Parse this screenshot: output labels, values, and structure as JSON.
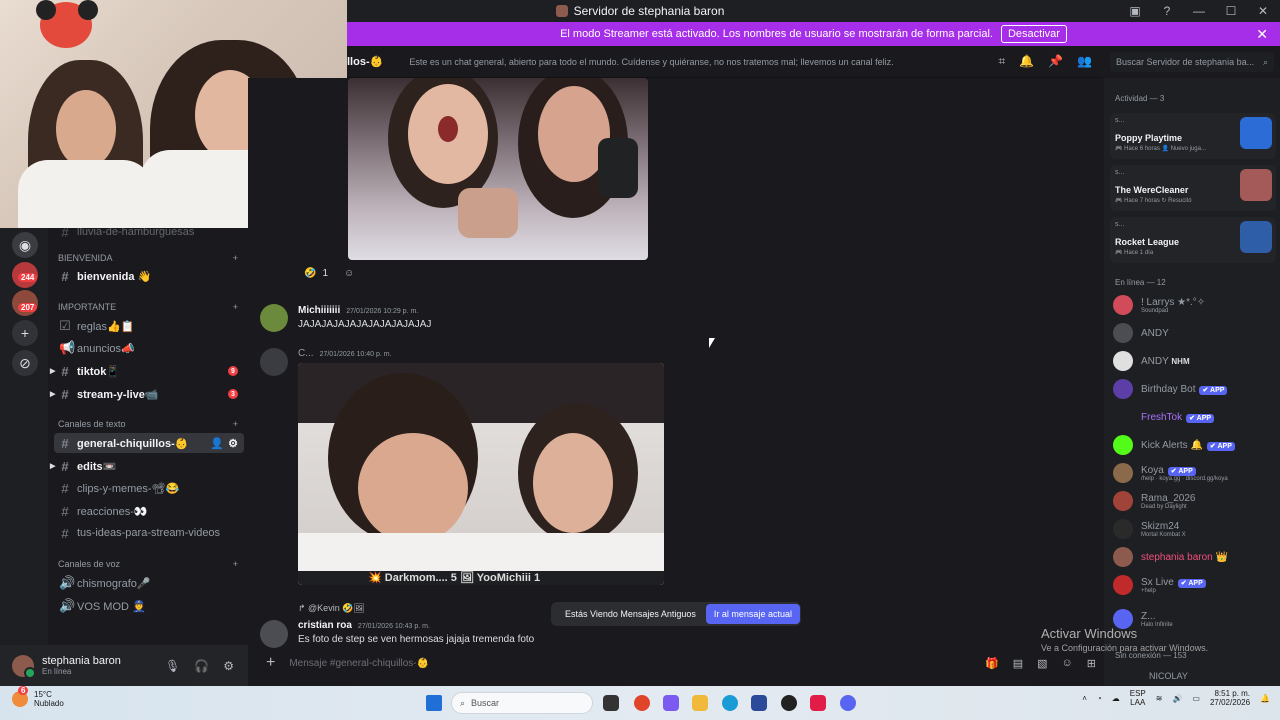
{
  "window": {
    "title": "Servidor de stephania baron",
    "controls": [
      "screen-icon",
      "help-icon",
      "minimize-icon",
      "maximize-icon",
      "close-icon"
    ]
  },
  "banner": {
    "text": "El modo Streamer está activado. Los nombres de usuario se mostrarán de forma parcial.",
    "button": "Desactivar",
    "color": "#a72ee8"
  },
  "header": {
    "channel": "llos-👶",
    "topic": "Este es un chat general, abierto para todo el mundo. Cuídense y quiéranse, no nos tratemos mal; llevemos un canal feliz.",
    "search_placeholder": "Buscar Servidor de stephania ba..."
  },
  "rail": {
    "badges": [
      "244",
      "207"
    ]
  },
  "channels": {
    "partial_top": "lluvia-de-hamburguesas",
    "categories": {
      "bienvenida": "BIENVENIDA",
      "importante": "IMPORTANTE",
      "texto": "Canales de texto",
      "voz": "Canales de voz"
    },
    "items": {
      "bienvenida": "bienvenida 👋",
      "reglas": "reglas👍📋",
      "anuncios": "anuncios📣",
      "tiktok": "tiktok📱",
      "tiktok_count": "9",
      "stream": "stream-y-live📹",
      "stream_count": "3",
      "general": "general-chiquillos-👶",
      "edits": "edits📼",
      "clips": "clips-y-memes-📽😂",
      "reacciones": "reacciones-👀",
      "ideas": "tus-ideas-para-stream-videos",
      "chismografo": "chismografo🎤",
      "vosmod": "VOS MOD 👮"
    }
  },
  "user_panel": {
    "name": "stephania baron",
    "status": "En línea"
  },
  "chat": {
    "reaction_count": "1",
    "messages": [
      {
        "author": "Michiiiiiii",
        "time": "27/01/2026 10:29 p. m.",
        "text": "JAJAJAJAJAJAJAJAJAJAJAJ"
      },
      {
        "author": "C...",
        "time": "27/01/2026 10:40 p. m."
      },
      {
        "reply": "@Kevin 🤣🖼",
        "author": "cristian roa",
        "time": "27/01/2026 10:43 p. m.",
        "text": "Es foto de step se ven hermosas jajaja tremenda foto"
      }
    ],
    "caption": "💥 Darkmom.... 5 🖼 YooMichiii 1",
    "old_msgs": "Estás Viendo Mensajes Antiguos",
    "jump": "Ir al mensaje actual",
    "composer": "Mensaje #general-chiquillos-👶"
  },
  "members": {
    "activity_header": "Actividad — 3",
    "activities": [
      {
        "mini": "s...",
        "game": "Poppy Playtime",
        "sub": "🎮 Hace 6 horas 👤 Nuevo juga..."
      },
      {
        "mini": "s...",
        "game": "The WereCleaner",
        "sub": "🎮 Hace 7 horas ↻ Resucitó"
      },
      {
        "mini": "s...",
        "game": "Rocket League",
        "sub": "🎮 Hace 1 día"
      }
    ],
    "online_header": "En línea — 12",
    "list": [
      {
        "name": "! Larrys ★*.°✧",
        "sub": "Soundpad",
        "color": "#949ba4"
      },
      {
        "name": "ANDY",
        "sub": "",
        "color": "#949ba4"
      },
      {
        "name": "ANDY",
        "sub": "",
        "tag": "NHM",
        "color": "#949ba4"
      },
      {
        "name": "Birthday Bot",
        "sub": "",
        "tag": "✔ APP",
        "color": "#949ba4"
      },
      {
        "name": "FreshTok",
        "sub": "",
        "tag": "✔ APP",
        "color": "#a970ff"
      },
      {
        "name": "Kick Alerts 🔔",
        "sub": "",
        "tag": "✔ APP",
        "color": "#949ba4"
      },
      {
        "name": "Koya",
        "sub": "/help · koya.gg · discord.gg/koya",
        "tag": "✔ APP",
        "color": "#949ba4"
      },
      {
        "name": "Rama_2026",
        "sub": "Dead by Daylight",
        "color": "#949ba4"
      },
      {
        "name": "Skizm24",
        "sub": "Mortal Kombat X",
        "color": "#949ba4"
      },
      {
        "name": "stephania baron 👑",
        "sub": "",
        "color": "#f04f7c"
      },
      {
        "name": "Sx Live",
        "sub": "+help",
        "tag": "✔ APP",
        "color": "#949ba4"
      },
      {
        "name": "Z...",
        "sub": "Halo Infinite",
        "color": "#949ba4"
      }
    ],
    "offline_header": "Sin conexión — 153",
    "offline_first": "NICOLAY"
  },
  "watermark": {
    "title": "Activar Windows",
    "sub": "Ve a Configuración para activar Windows."
  },
  "taskbar": {
    "weather_temp": "15°C",
    "weather_desc": "Nublado",
    "weather_badge": "6",
    "search": "Buscar",
    "lang1": "ESP",
    "lang2": "LAA",
    "time": "8:51 p. m.",
    "date": "27/02/2026"
  }
}
